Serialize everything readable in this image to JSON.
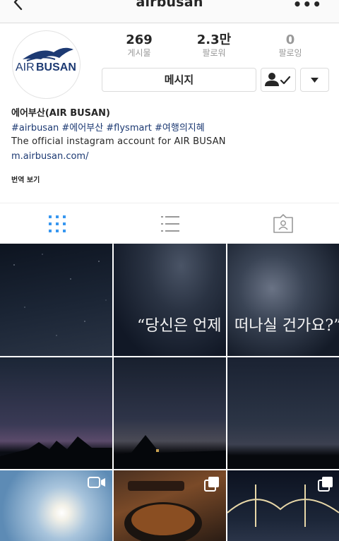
{
  "header": {
    "username": "airbusan",
    "back_icon": "chevron-left-icon",
    "more_icon": "more-dots-icon"
  },
  "profile": {
    "logo_text_air": "AIR",
    "logo_text_busan": "BUSAN",
    "stats": [
      {
        "value": "269",
        "label": "게시물"
      },
      {
        "value": "2.3만",
        "label": "팔로워"
      },
      {
        "value": "0",
        "label": "팔로잉"
      }
    ],
    "message_button": "메시지",
    "bio": {
      "name": "에어부산(AIR BUSAN)",
      "hashtags": "#airbusan #에어부산 #flysmart #여행의지혜",
      "description": "The official instagram account for AIR BUSAN",
      "link": "m.airbusan.com/",
      "translate": "번역 보기"
    }
  },
  "tabs": [
    "grid-icon",
    "list-icon",
    "tagged-icon"
  ],
  "posts": {
    "overlay_left": "“당신은 언제",
    "overlay_right": "떠나실 건가요?”"
  },
  "colors": {
    "brand_blue": "#1d3a73",
    "tab_active": "#3897f0"
  }
}
